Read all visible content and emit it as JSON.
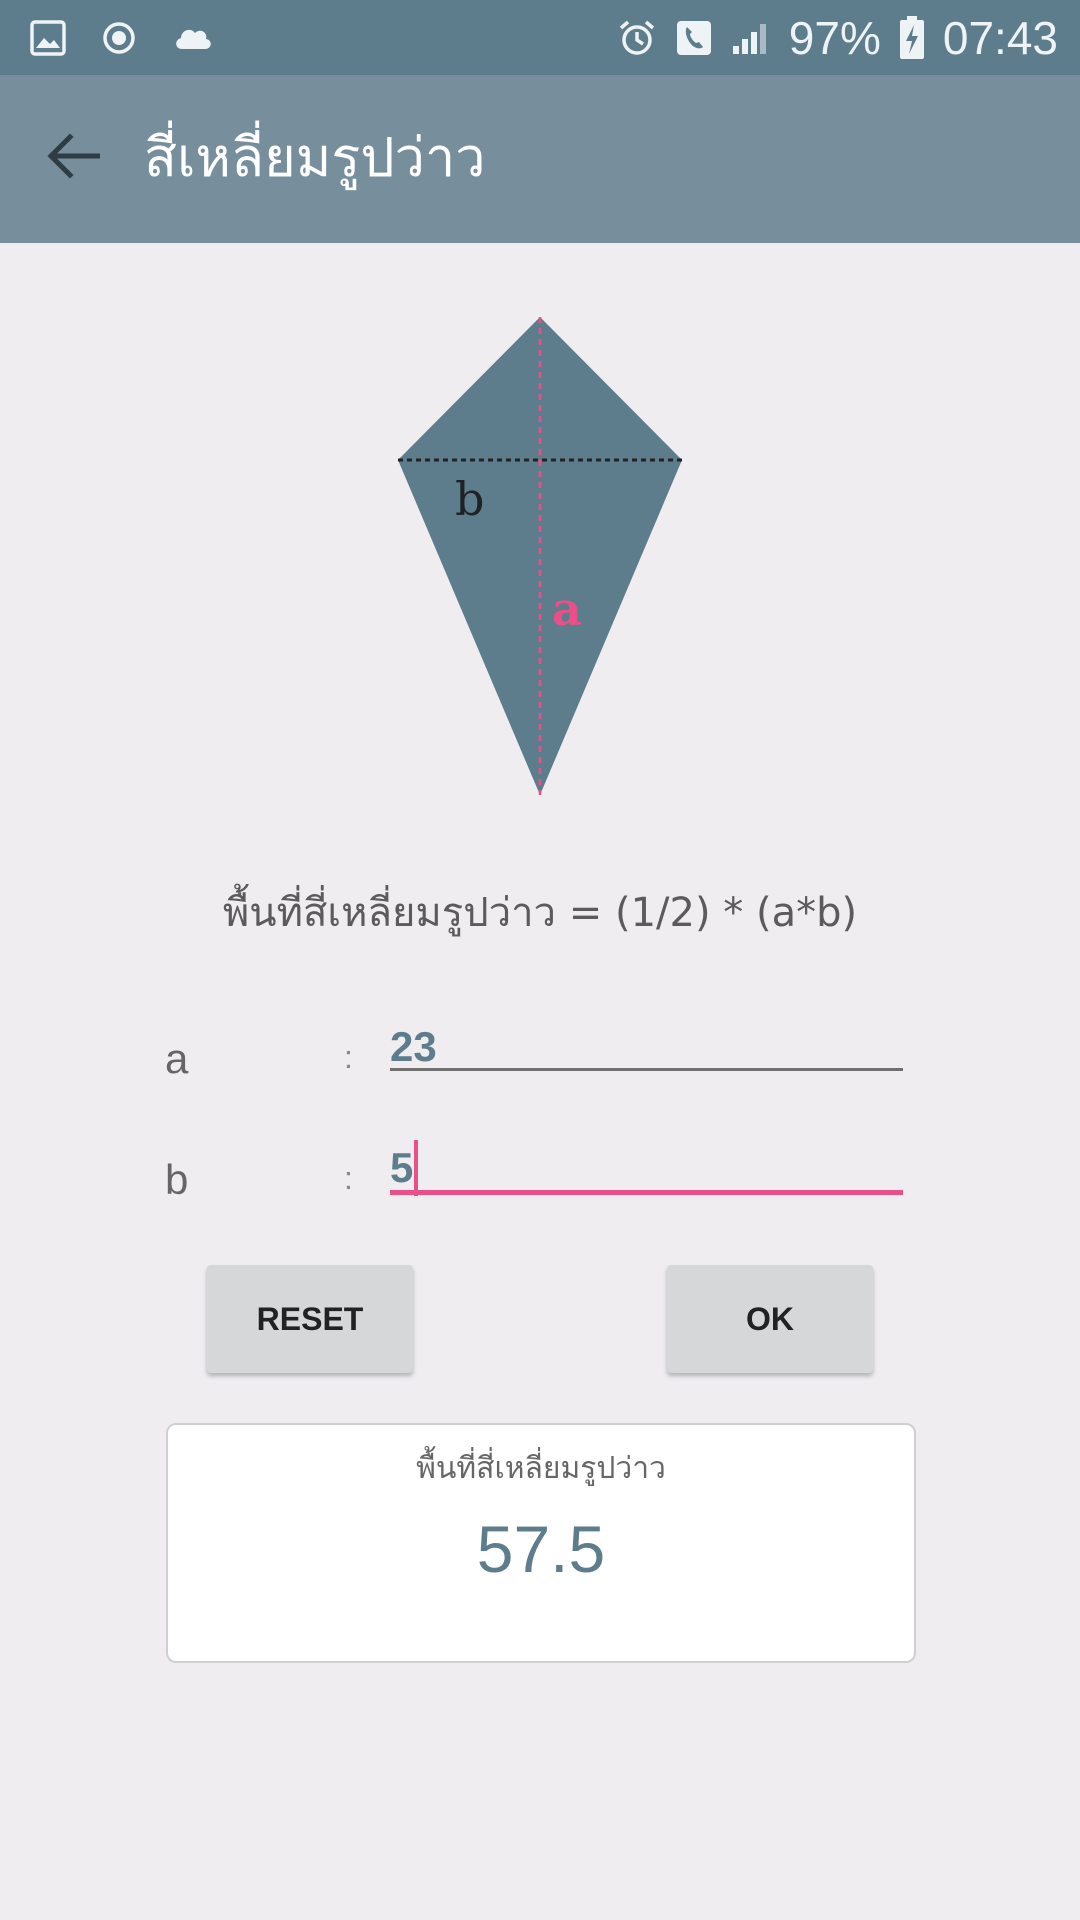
{
  "status_bar": {
    "battery": "97%",
    "time": "07:43",
    "icons": [
      "gallery-icon",
      "record-icon",
      "cloud-icon",
      "alarm-icon",
      "call-icon",
      "signal-icon",
      "battery-charging-icon"
    ]
  },
  "app_bar": {
    "title": "สี่เหลี่ยมรูปว่าว",
    "back_icon": "arrow-left-icon"
  },
  "diagram": {
    "label_a": "a",
    "label_b": "b",
    "fill_color": "#5e7d8c",
    "a_color": "#e94f88"
  },
  "formula": "พื้นที่สี่เหลี่ยมรูปว่าว = (1/2) * (a*b)",
  "fields": {
    "a": {
      "label": "a",
      "colon": ":",
      "value": "23"
    },
    "b": {
      "label": "b",
      "colon": ":",
      "value": "5"
    }
  },
  "buttons": {
    "reset": "RESET",
    "ok": "OK"
  },
  "result": {
    "label": "พื้นที่สี่เหลี่ยมรูปว่าว",
    "value": "57.5"
  },
  "colors": {
    "status_bar": "#5e7d8c",
    "app_bar": "#778f9c",
    "accent": "#e94f88",
    "background": "#efedf0"
  }
}
